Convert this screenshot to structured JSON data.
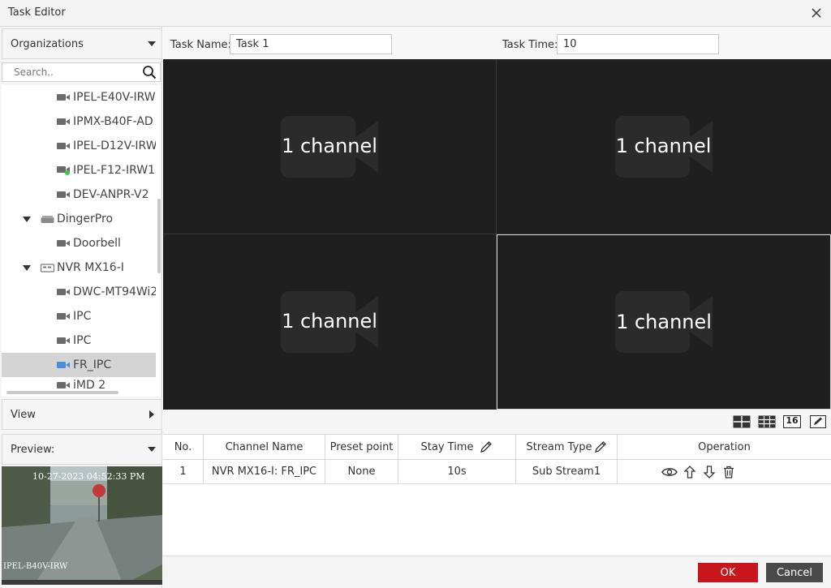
{
  "window": {
    "title": "Task Editor"
  },
  "sidebar": {
    "organizations_label": "Organizations",
    "search_placeholder": "Search..",
    "tree": [
      {
        "label": "IPEL-E40V-IRW",
        "type": "camera",
        "level": 2
      },
      {
        "label": "IPMX-B40F-AD",
        "type": "camera",
        "level": 2
      },
      {
        "label": "IPEL-D12V-IRW",
        "type": "camera",
        "level": 2
      },
      {
        "label": "IPEL-F12-IRW1",
        "type": "camera-online",
        "level": 2
      },
      {
        "label": "DEV-ANPR-V2",
        "type": "camera",
        "level": 2
      },
      {
        "label": "DingerPro",
        "type": "device",
        "level": 1,
        "expanded": true
      },
      {
        "label": "Doorbell",
        "type": "camera",
        "level": 2
      },
      {
        "label": "NVR MX16-I",
        "type": "nvr",
        "level": 1,
        "expanded": true
      },
      {
        "label": "DWC-MT94Wi2",
        "type": "camera",
        "level": 2
      },
      {
        "label": "IPC",
        "type": "camera",
        "level": 2
      },
      {
        "label": "IPC",
        "type": "camera",
        "level": 2
      },
      {
        "label": "FR_IPC",
        "type": "camera-selected",
        "level": 2,
        "selected": true
      },
      {
        "label": "iMD 2",
        "type": "camera",
        "level": 2
      }
    ],
    "view_label": "View",
    "preview_label": "Preview:",
    "preview": {
      "timestamp": "10-27-2023 04:52:33 PM",
      "camera_name": "IPEL-B40V-IRW"
    }
  },
  "form": {
    "task_name_label": "Task Name:",
    "task_name_value": "Task 1",
    "task_time_label": "Task Time:",
    "task_time_value": "10"
  },
  "video_cells": [
    {
      "label": "1 channel",
      "active": false
    },
    {
      "label": "1 channel",
      "active": false
    },
    {
      "label": "1 channel",
      "active": false
    },
    {
      "label": "1 channel",
      "active": true
    }
  ],
  "layout_buttons": [
    {
      "icon": "grid-2x2-icon"
    },
    {
      "icon": "grid-3x3-icon"
    },
    {
      "icon": "grid-16-icon",
      "label": "16"
    },
    {
      "icon": "custom-layout-edit-icon"
    }
  ],
  "table": {
    "headers": {
      "no": "No.",
      "channel_name": "Channel Name",
      "preset_point": "Preset point",
      "stay_time": "Stay Time",
      "stream_type": "Stream Type",
      "operation": "Operation"
    },
    "rows": [
      {
        "no": "1",
        "channel_name": "NVR MX16-I: FR_IPC",
        "preset_point": "None",
        "stay_time": "10s",
        "stream_type": "Sub Stream1"
      }
    ]
  },
  "footer": {
    "ok_label": "OK",
    "cancel_label": "Cancel"
  },
  "colors": {
    "ok": "#c8161d",
    "cancel": "#4a4a4a",
    "video_bg": "#1f1f1f",
    "selected_row": "#d4d4d4",
    "online_dot": "#3ec93e"
  }
}
